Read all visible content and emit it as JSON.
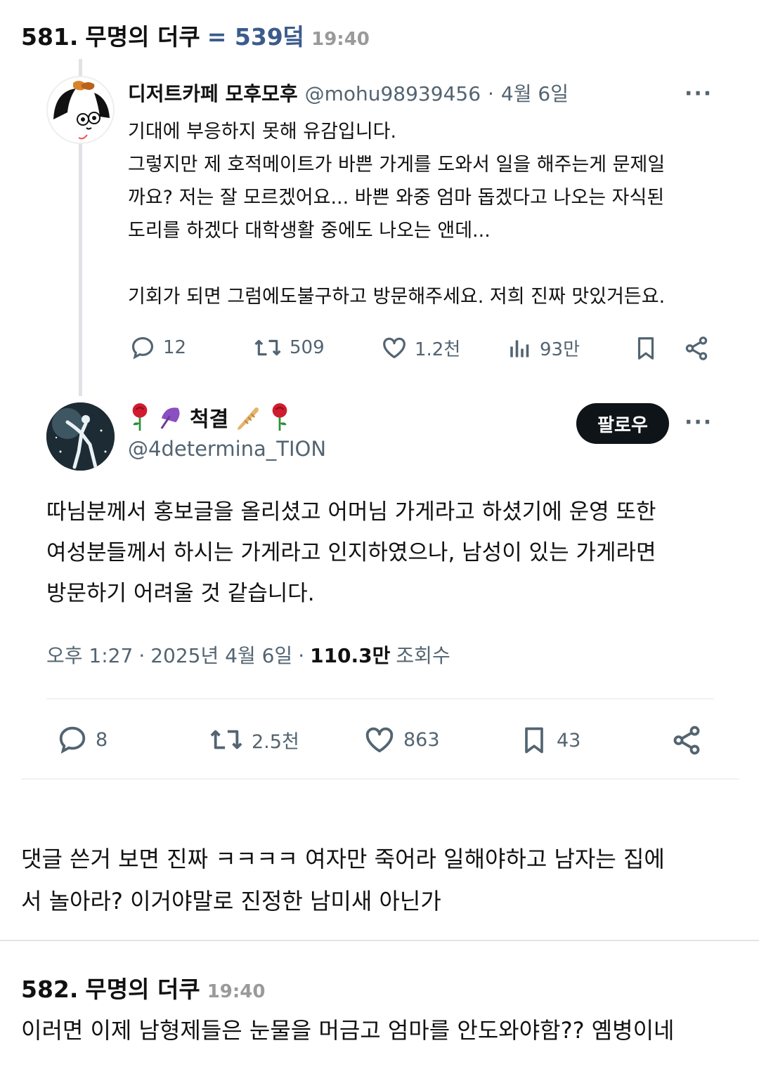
{
  "post1": {
    "number": "581.",
    "author": "무명의 더쿠",
    "ref": "= 539덬",
    "time": "19:40"
  },
  "tweet1": {
    "display_name": "디저트카페 모후모후",
    "handle": "@mohu98939456",
    "separator": "·",
    "date": "4월 6일",
    "more": "···",
    "lines": [
      "기대에 부응하지 못해 유감입니다.",
      "그렇지만 제 호적메이트가 바쁜 가게를 도와서 일을 해주는게 문제일",
      "까요? 저는 잘 모르겠어요... 바쁜 와중 엄마 돕겠다고 나오는 자식된",
      "도리를 하겠다 대학생활 중에도 나오는 앤데...",
      "",
      "기회가 되면 그럼에도불구하고 방문해주세요. 저희 진짜 맛있거든요."
    ],
    "actions": {
      "replies": "12",
      "retweets": "509",
      "likes": "1.2천",
      "views": "93만"
    }
  },
  "tweet2": {
    "display_name": "척결",
    "handle": "@4determina_TION",
    "follow_label": "팔로우",
    "more": "···",
    "lines": [
      "따님분께서 홍보글을 올리셨고 어머님 가게라고 하셨기에 운영 또한",
      "여성분들께서 하시는 가게라고 인지하였으나, 남성이 있는 가게라면",
      "방문하기 어려울 것 같습니다."
    ],
    "meta": {
      "time": "오후 1:27",
      "sep1": "·",
      "date": "2025년 4월 6일",
      "sep2": "·",
      "views": "110.3만",
      "views_label": "조회수"
    },
    "actions": {
      "replies": "8",
      "retweets": "2.5천",
      "likes": "863",
      "bookmarks": "43"
    }
  },
  "comment": {
    "lines": [
      "댓글 쓴거 보면 진짜 ㅋㅋㅋㅋ 여자만 죽어라 일해야하고 남자는 집에",
      "서 놀아라? 이거야말로 진정한 남미새 아닌가"
    ]
  },
  "post2": {
    "number": "582.",
    "author": "무명의 더쿠",
    "time": "19:40",
    "body": "이러면 이제 남형제들은 눈물을 머금고 엄마를 안도와야함?? 옘병이네"
  },
  "colors": {
    "ref_blue": "#3b5b8c",
    "muted": "#536471",
    "follow_bg": "#0f1419"
  },
  "icons": [
    "reply-icon",
    "retweet-icon",
    "like-icon",
    "views-icon",
    "bookmark-icon",
    "share-icon",
    "rose-icon",
    "umbrella-icon",
    "bread-icon"
  ]
}
